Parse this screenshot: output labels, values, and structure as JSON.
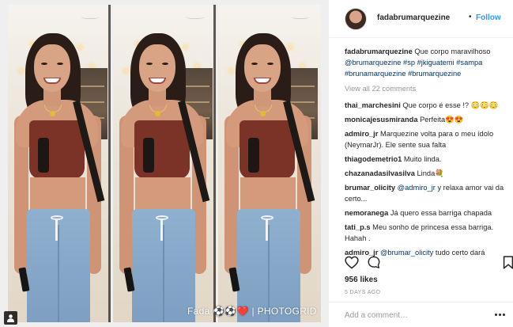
{
  "photo": {
    "watermark_left": "Fada ",
    "watermark_emoji": "⚽⚽❤️",
    "watermark_sep": " | ",
    "watermark_brand": "PHOTOGRID"
  },
  "header": {
    "username": "fadabrumarquezine",
    "dot": "•",
    "follow_label": "Follow"
  },
  "caption": {
    "username": "fadabrumarquezine",
    "text": " Que corpo maravilhoso ",
    "tags": [
      "@brumarquezine",
      "#sp",
      "#jkiguatemi",
      "#sampa",
      "#brunamarquezine",
      "#brumarquezine"
    ]
  },
  "view_all": "View all 22 comments",
  "comments": [
    {
      "user": "thai_marchesini",
      "text": " Que corpo é esse !? 😳😳😳"
    },
    {
      "user": "monicajesusmiranda",
      "text": " Perfeita😍😍"
    },
    {
      "user": "admiro_jr",
      "text": " Marquezine volta para o meu ídolo (NeymarJr). Ele sente sua falta"
    },
    {
      "user": "thiagodemetrio1",
      "text": " Muito linda."
    },
    {
      "user": "chazanadasilvasilva",
      "text": " Linda💐"
    },
    {
      "user": "brumar_olicity",
      "mention": "@admiro_jr",
      "text": " y relaxa amor vai da certo..."
    },
    {
      "user": "nemoranega",
      "text": " Já quero essa barriga chapada"
    },
    {
      "user": "tati_p.s",
      "text": " Meu sonho de princesa essa barriga. Hahah ."
    },
    {
      "user": "admiro_jr",
      "mention": "@brumar_olicity",
      "text": " tudo certo dará"
    }
  ],
  "actions": {
    "like_icon": "heart-icon",
    "comment_icon": "comment-icon",
    "save_icon": "bookmark-icon"
  },
  "likes": "956 likes",
  "date": "5 DAYS AGO",
  "add_comment": {
    "placeholder": "Add a comment…",
    "more_icon": "more-icon"
  },
  "colors": {
    "link": "#3897f0",
    "hashtag": "#003569",
    "muted": "#999999",
    "text": "#262626"
  }
}
